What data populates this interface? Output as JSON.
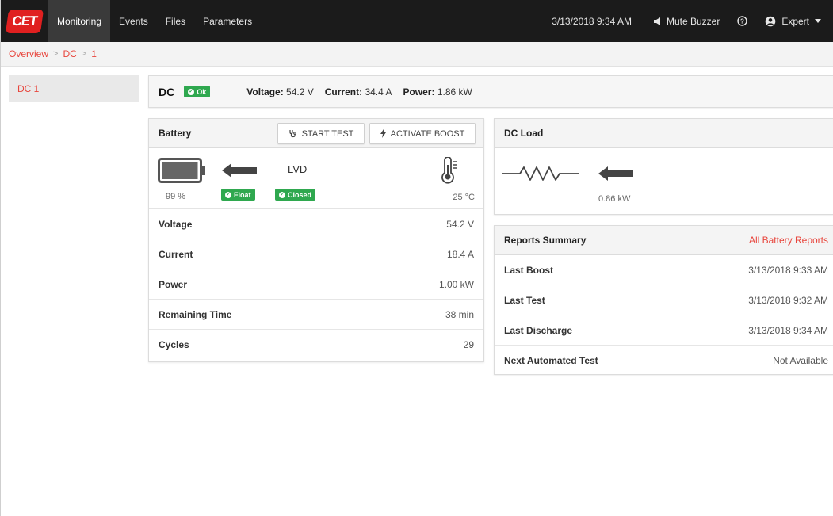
{
  "nav": {
    "logo_text": "CET",
    "items": [
      "Monitoring",
      "Events",
      "Files",
      "Parameters"
    ],
    "datetime": "3/13/2018 9:34 AM",
    "mute": "Mute Buzzer",
    "user": "Expert"
  },
  "breadcrumb": [
    "Overview",
    "DC",
    "1"
  ],
  "sidebar": {
    "items": [
      "DC 1"
    ]
  },
  "summary": {
    "title": "DC",
    "status": "Ok",
    "voltage_label": "Voltage:",
    "voltage": "54.2 V",
    "current_label": "Current:",
    "current": "34.4 A",
    "power_label": "Power:",
    "power": "1.86 kW"
  },
  "battery": {
    "title": "Battery",
    "start_test": "START TEST",
    "activate_boost": "ACTIVATE BOOST",
    "charge": "99 %",
    "charge_level": 0.99,
    "mode": "Float",
    "lvd_label": "LVD",
    "lvd_state": "Closed",
    "temperature": "25 °C",
    "rows": [
      {
        "label": "Voltage",
        "value": "54.2 V"
      },
      {
        "label": "Current",
        "value": "18.4 A"
      },
      {
        "label": "Power",
        "value": "1.00 kW"
      },
      {
        "label": "Remaining Time",
        "value": "38 min"
      },
      {
        "label": "Cycles",
        "value": "29"
      }
    ]
  },
  "dc_load": {
    "title": "DC Load",
    "power": "0.86 kW"
  },
  "reports": {
    "title": "Reports Summary",
    "link": "All Battery Reports",
    "rows": [
      {
        "label": "Last Boost",
        "value": "3/13/2018 9:33 AM"
      },
      {
        "label": "Last Test",
        "value": "3/13/2018 9:32 AM"
      },
      {
        "label": "Last Discharge",
        "value": "3/13/2018 9:34 AM"
      },
      {
        "label": "Next Automated Test",
        "value": "Not Available"
      }
    ]
  },
  "colors": {
    "accent": "#e8453c",
    "ok_green": "#2fa84f",
    "topbar": "#1b1b1b"
  },
  "icons": [
    "speaker-icon",
    "help-icon",
    "user-circle-icon",
    "stethoscope-icon",
    "lightning-icon",
    "battery-icon",
    "arrow-left-icon",
    "thermometer-icon",
    "resistor-icon",
    "check-icon"
  ]
}
